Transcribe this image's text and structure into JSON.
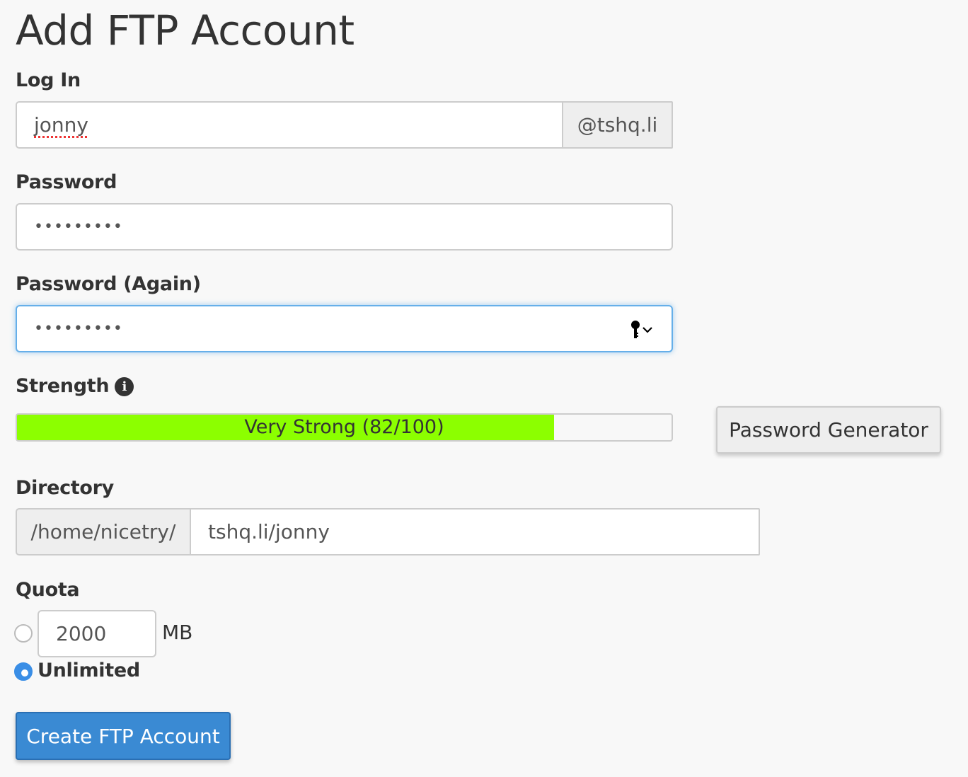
{
  "page": {
    "title": "Add FTP Account"
  },
  "login": {
    "label": "Log In",
    "value": "jonny",
    "domain_suffix": "@tshq.li"
  },
  "password": {
    "label": "Password",
    "masked_value": "•••••••••"
  },
  "password_again": {
    "label": "Password (Again)",
    "masked_value": "•••••••••",
    "key_icon": "key-icon",
    "chevron_icon": "chevron-down-icon"
  },
  "strength": {
    "label": "Strength",
    "info_icon": "info-circle-icon",
    "bar_text": "Very Strong (82/100)",
    "score": 82,
    "max": 100,
    "bar_color": "#8cff00",
    "generator_button": "Password Generator"
  },
  "directory": {
    "label": "Directory",
    "prefix": "/home/nicetry/",
    "value": "tshq.li/jonny"
  },
  "quota": {
    "label": "Quota",
    "limit_value": "2000",
    "unit": "MB",
    "unlimited_label": "Unlimited",
    "selected": "unlimited"
  },
  "actions": {
    "create_button": "Create FTP Account",
    "accent_color": "#3a8ad3"
  }
}
